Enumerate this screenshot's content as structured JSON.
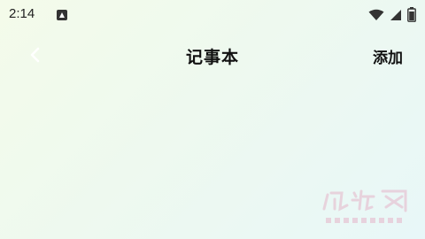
{
  "status_bar": {
    "time": "2:14",
    "icons": [
      "android-notification-icon",
      "wifi-icon",
      "cell-signal-icon",
      "battery-icon"
    ]
  },
  "app_bar": {
    "back_icon": "chevron-left-icon",
    "title": "记事本",
    "add_label": "添加"
  },
  "colors": {
    "background_start": "#f4fbea",
    "background_end": "#e8f7f8",
    "text": "#111111",
    "back_icon": "#ffffff",
    "watermark": "#e6b5c9"
  },
  "watermark": {
    "brand": "logo-watermark"
  }
}
